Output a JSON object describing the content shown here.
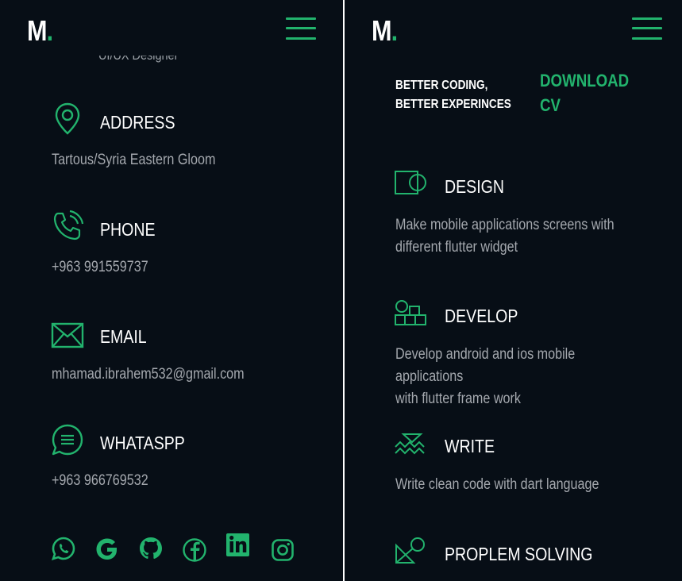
{
  "colors": {
    "background": "#070e16",
    "accent": "#22b36d",
    "text": "#ffffff",
    "muted": "#a4a8ae"
  },
  "logo": {
    "letter": "M",
    "dot": "."
  },
  "left": {
    "cut_text": "UI/UX Designer",
    "contacts": [
      {
        "icon": "location-pin-icon",
        "title": "ADDRESS",
        "value": "Tartous/Syria Eastern Gloom"
      },
      {
        "icon": "phone-icon",
        "title": "PHONE",
        "value": "+963 991559737"
      },
      {
        "icon": "envelope-icon",
        "title": "EMAIL",
        "value": "mhamad.ibrahem532@gmail.com"
      },
      {
        "icon": "chat-icon",
        "title": "WHATASPP",
        "value": "+963 966769532"
      }
    ],
    "social": [
      "whatsapp-icon",
      "google-icon",
      "github-icon",
      "facebook-icon",
      "linkedin-icon",
      "instagram-icon"
    ]
  },
  "right": {
    "tagline_1": "BETTER CODING,",
    "tagline_2": "BETTER EXPERINCES",
    "download_1": "DOWNLOAD",
    "download_2": "CV",
    "services": [
      {
        "icon": "design-icon",
        "title": "DESIGN",
        "desc_1": "Make mobile applications screens with",
        "desc_2": "different flutter widget"
      },
      {
        "icon": "develop-icon",
        "title": "DEVELOP",
        "desc_1": "Develop android and ios mobile applications",
        "desc_2": "with flutter frame work"
      },
      {
        "icon": "write-icon",
        "title": "WRITE",
        "desc_1": "Write clean code with dart language",
        "desc_2": ""
      },
      {
        "icon": "problem-solving-icon",
        "title": "PROPLEM SOLVING",
        "desc_1": "",
        "desc_2": ""
      }
    ]
  }
}
